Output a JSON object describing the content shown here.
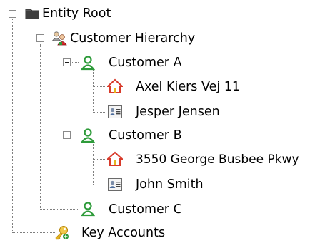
{
  "tree": {
    "root": {
      "label": "Entity Root",
      "icon": "folder-icon",
      "expanded": true
    },
    "customer_hierarchy": {
      "label": "Customer Hierarchy",
      "icon": "users-group-icon",
      "expanded": true
    },
    "customer_a": {
      "label": "Customer A",
      "icon": "customer-icon",
      "expanded": true,
      "address": {
        "label": "Axel Kiers Vej 11",
        "icon": "home-icon"
      },
      "contact": {
        "label": "Jesper Jensen",
        "icon": "contact-card-icon"
      }
    },
    "customer_b": {
      "label": "Customer B",
      "icon": "customer-icon",
      "expanded": true,
      "address": {
        "label": "3550 George Busbee Pkwy",
        "icon": "home-icon"
      },
      "contact": {
        "label": "John Smith",
        "icon": "contact-card-icon"
      }
    },
    "customer_c": {
      "label": "Customer C",
      "icon": "customer-icon"
    },
    "key_accounts": {
      "label": "Key Accounts",
      "icon": "key-accounts-icon"
    }
  },
  "colors": {
    "folder": "#4a4a4a",
    "customer_green": "#2e9b3a",
    "home_red": "#d83a2a",
    "key_gold": "#e6b520",
    "tree_line": "#7f7f7f"
  }
}
